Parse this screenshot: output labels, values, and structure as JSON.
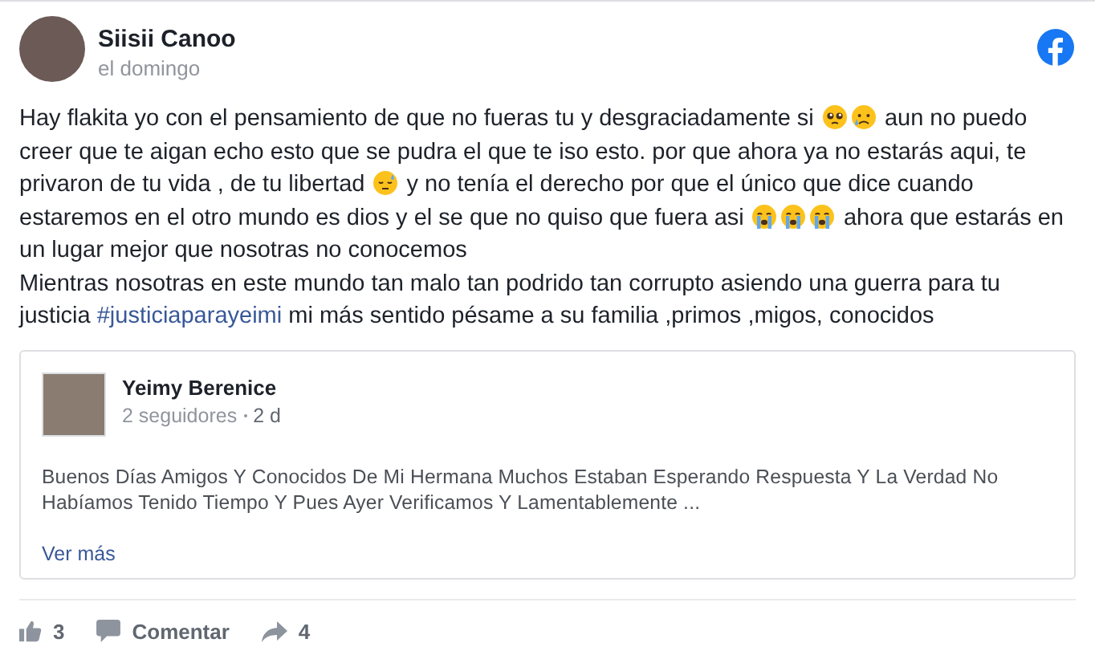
{
  "author": {
    "name": "Siisii Canoo",
    "time": "el domingo"
  },
  "body": [
    [
      {
        "kind": "text",
        "text": "Hay flakita yo con el pensamiento de que no fueras tu y desgraciadamente si "
      },
      {
        "kind": "pleading"
      },
      {
        "kind": "sad"
      },
      {
        "kind": "text",
        "text": " aun no puedo creer que te aigan echo esto que se pudra el que te iso esto. por que ahora ya no estarás aqui, te privaron de tu vida , de tu libertad "
      },
      {
        "kind": "sweat"
      },
      {
        "kind": "text",
        "text": " y no tenía el derecho por que el único que dice cuando estaremos en el otro mundo es dios y el se que no quiso que fuera asi "
      },
      {
        "kind": "crying"
      },
      {
        "kind": "crying"
      },
      {
        "kind": "crying"
      },
      {
        "kind": "text",
        "text": " ahora que estarás en un lugar mejor que nosotras no conocemos"
      }
    ],
    [
      {
        "kind": "text",
        "text": "Mientras nosotras en este mundo tan malo tan podrido tan corrupto asiendo una guerra para tu justicia "
      },
      {
        "kind": "hashtag",
        "text": "#justiciaparayeimi"
      },
      {
        "kind": "text",
        "text": " mi más sentido pésame a su familia ,primos ,migos, conocidos"
      }
    ]
  ],
  "shared_post": {
    "author": "Yeimy Berenice",
    "meta": "2 seguidores",
    "age": "2 d",
    "text": "Buenos Días Amigos Y Conocidos De Mi Hermana Muchos Estaban Esperando Respuesta Y La Verdad No Habíamos Tenido Tiempo Y Pues Ayer Verificamos Y Lamentablemente ...",
    "link": "Ver más"
  },
  "actions": [
    {
      "kind": "like",
      "label": "3"
    },
    {
      "kind": "comment",
      "label": "Comentar"
    },
    {
      "kind": "share",
      "label": "4"
    }
  ]
}
